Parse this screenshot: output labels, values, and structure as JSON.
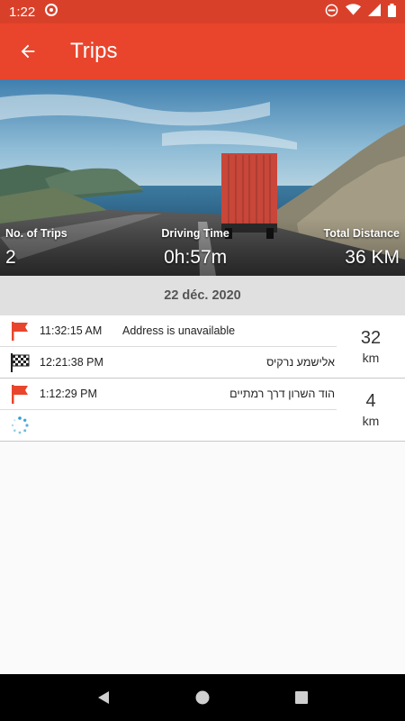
{
  "status_bar": {
    "time": "1:22"
  },
  "app_bar": {
    "title": "Trips"
  },
  "summary": {
    "trips_label": "No. of Trips",
    "trips_value": "2",
    "driving_label": "Driving Time",
    "driving_value": "0h:57m",
    "distance_label": "Total Distance",
    "distance_value": "36 KM"
  },
  "date_header": "22 déc. 2020",
  "trips": [
    {
      "start_time": "11:32:15 AM",
      "start_address": "Address is unavailable",
      "end_time": "12:21:38 PM",
      "end_address": "אלישמע נרקיס",
      "distance": "32",
      "unit": "km"
    },
    {
      "start_time": "1:12:29 PM",
      "start_address": "הוד השרון דרך רמתיים",
      "end_time": "",
      "end_address": "",
      "distance": "4",
      "unit": "km"
    }
  ],
  "colors": {
    "primary": "#e8452c",
    "primary_dark": "#d9402a"
  }
}
